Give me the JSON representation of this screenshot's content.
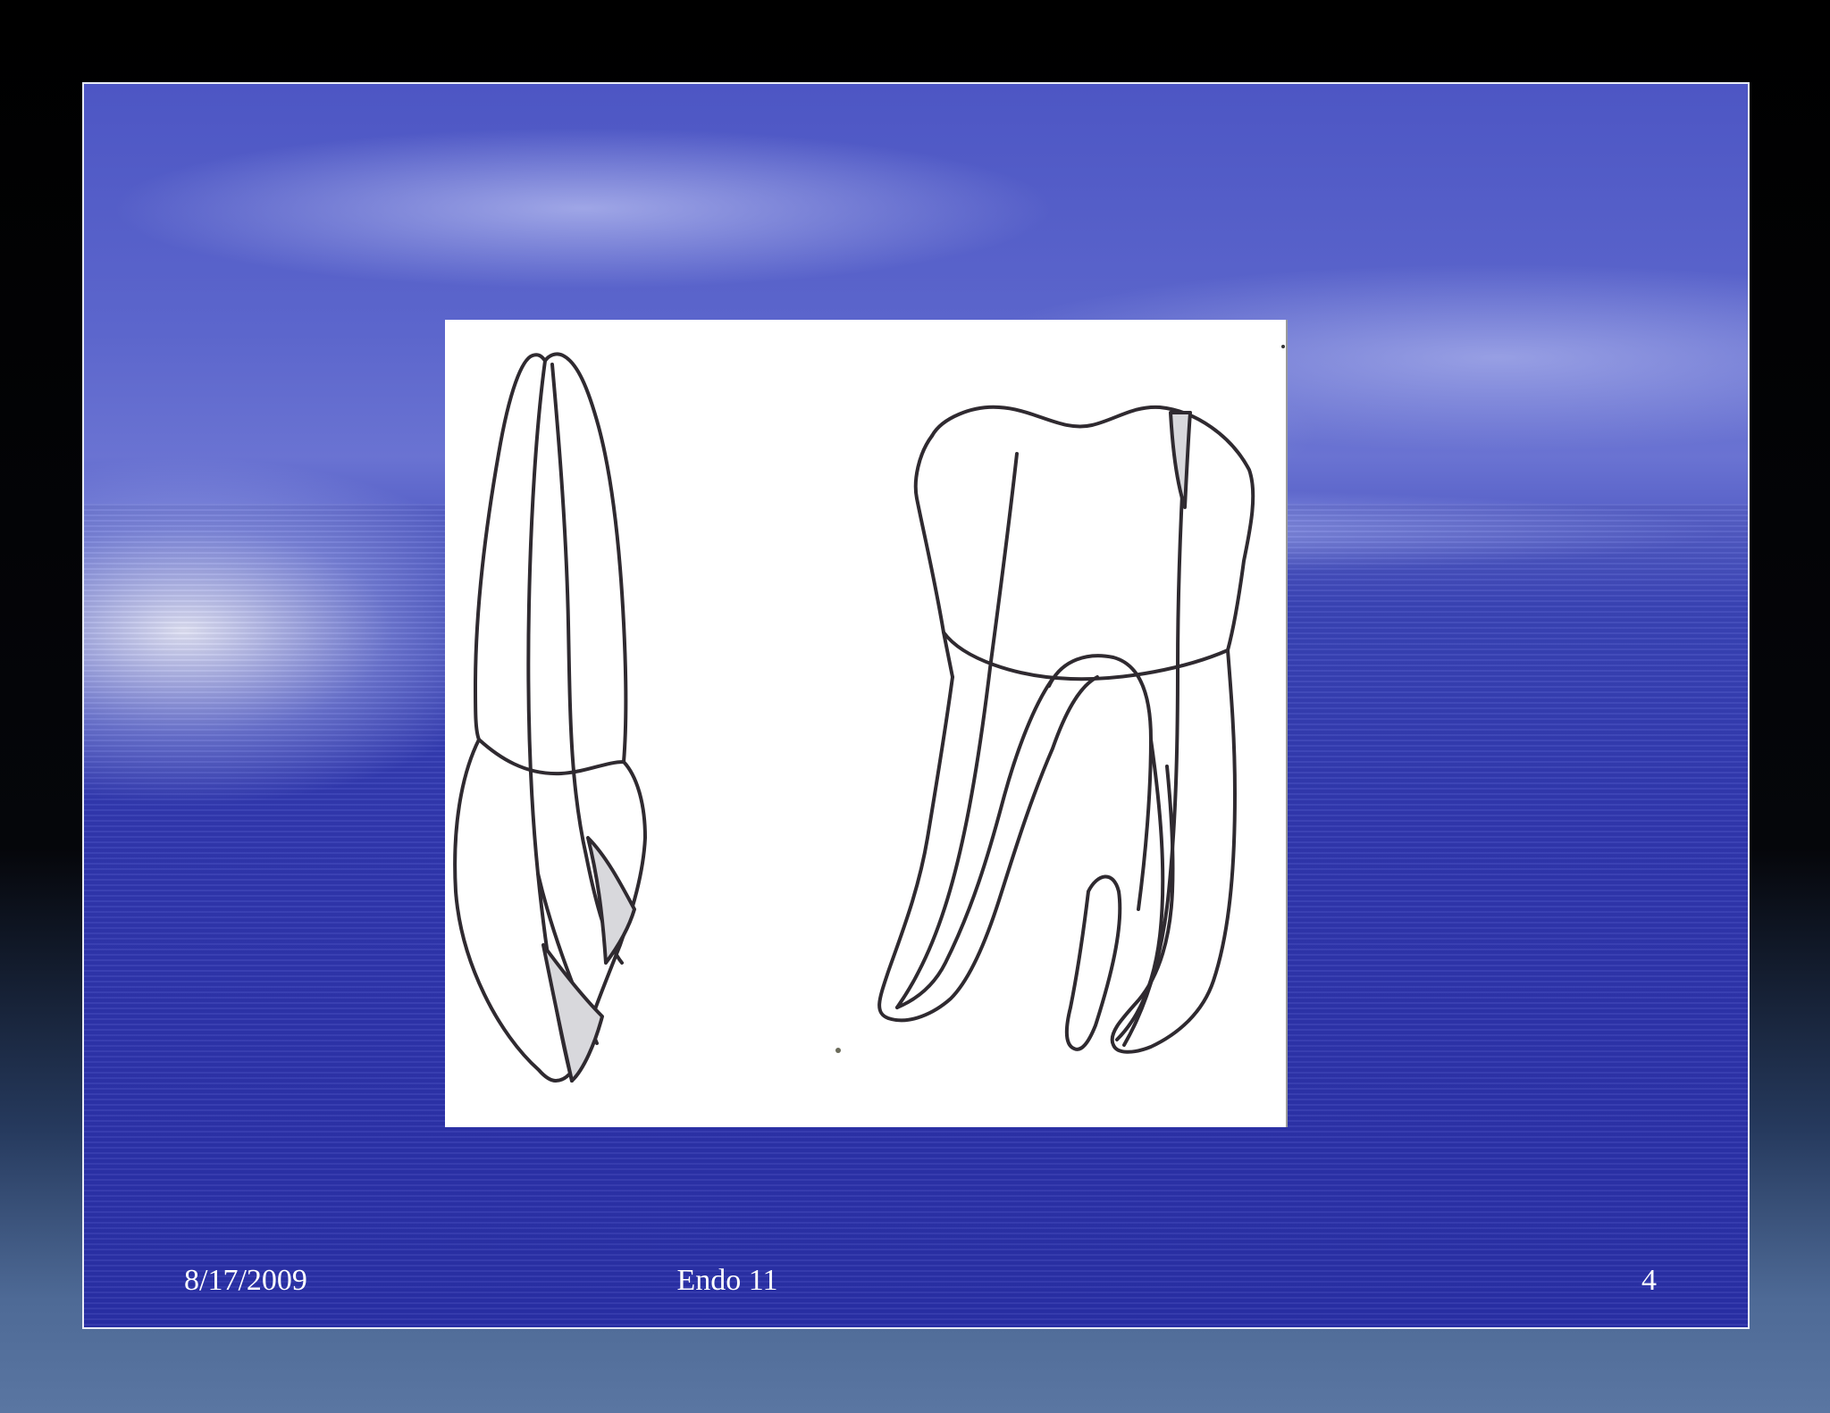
{
  "footer": {
    "date": "8/17/2009",
    "title": "Endo 11",
    "page_number": "4"
  },
  "colors": {
    "outline": "#2f2a30",
    "canal_fill": "#d8d8dc"
  }
}
